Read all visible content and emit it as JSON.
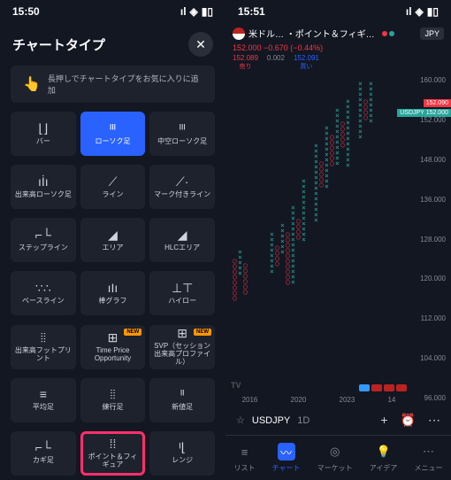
{
  "left": {
    "time": "15:50",
    "title": "チャートタイプ",
    "hint": "長押しでチャートタイプをお気に入りに追加",
    "cells": [
      {
        "i": "⌊⌋",
        "l": "バー"
      },
      {
        "i": "ᴵᴵᴵ",
        "l": "ローソク足",
        "sel": true
      },
      {
        "i": "ᴵᴵᴵ",
        "l": "中空ローソク足"
      },
      {
        "i": "ıİı",
        "l": "出来高ローソク足"
      },
      {
        "i": "⟋",
        "l": "ライン"
      },
      {
        "i": "⟋·",
        "l": "マーク付きライン"
      },
      {
        "i": "⌐└",
        "l": "ステップライン"
      },
      {
        "i": "◢",
        "l": "エリア"
      },
      {
        "i": "◢",
        "l": "HLCエリア"
      },
      {
        "i": "∵∴",
        "l": "ベースライン"
      },
      {
        "i": "ıIı",
        "l": "棒グラフ"
      },
      {
        "i": "⊥⊤",
        "l": "ハイロー"
      },
      {
        "i": "⦙⦙",
        "l": "出来高フットプリント"
      },
      {
        "i": "⊞",
        "l": "Time Price Opportunity",
        "new": true
      },
      {
        "i": "⊞",
        "l": "SVP（セッション出来高プロファイル）",
        "new": true
      },
      {
        "i": "≡",
        "l": "平均足"
      },
      {
        "i": "⦙⦙",
        "l": "練行足"
      },
      {
        "i": "ᴵᴵ",
        "l": "新値足"
      },
      {
        "i": "⌐└",
        "l": "カギ足"
      },
      {
        "i": "⁞⁞",
        "l": "ポイント＆フィギュア",
        "hl": true
      },
      {
        "i": "ᴵ⌊",
        "l": "レンジ"
      }
    ],
    "new_badge": "NEW"
  },
  "right": {
    "time": "15:51",
    "sym": "米ドル… ・ポイント＆フィギ…",
    "jpy": "JPY",
    "price": "152.000 −0.670 (−0.44%)",
    "sell": "152.089",
    "sell_l": "売り",
    "spread": "0.002",
    "buy": "152.091",
    "buy_l": "買い",
    "ytags": [
      {
        "t": "152.090",
        "c": "#f23645",
        "y": "8%"
      },
      {
        "t": "USDJPY",
        "c": "#26a69a",
        "y": "11%",
        "t2": "152.000"
      }
    ],
    "yticks": [
      "160.000",
      "152.000",
      "148.000",
      "136.000",
      "128.000",
      "120.000",
      "112.000",
      "104.000",
      "96.000"
    ],
    "xticks": [
      "2016",
      "2020",
      "2023",
      "14"
    ],
    "tv": "TV",
    "sym2": "USDJPY",
    "tf": "1D",
    "tabs": [
      {
        "i": "≡",
        "l": "リスト"
      },
      {
        "i": "〰",
        "l": "チャート",
        "act": true
      },
      {
        "i": "◎",
        "l": "マーケット"
      },
      {
        "i": "💡",
        "l": "アイデア"
      },
      {
        "i": "⋯",
        "l": "メニュー"
      }
    ]
  }
}
